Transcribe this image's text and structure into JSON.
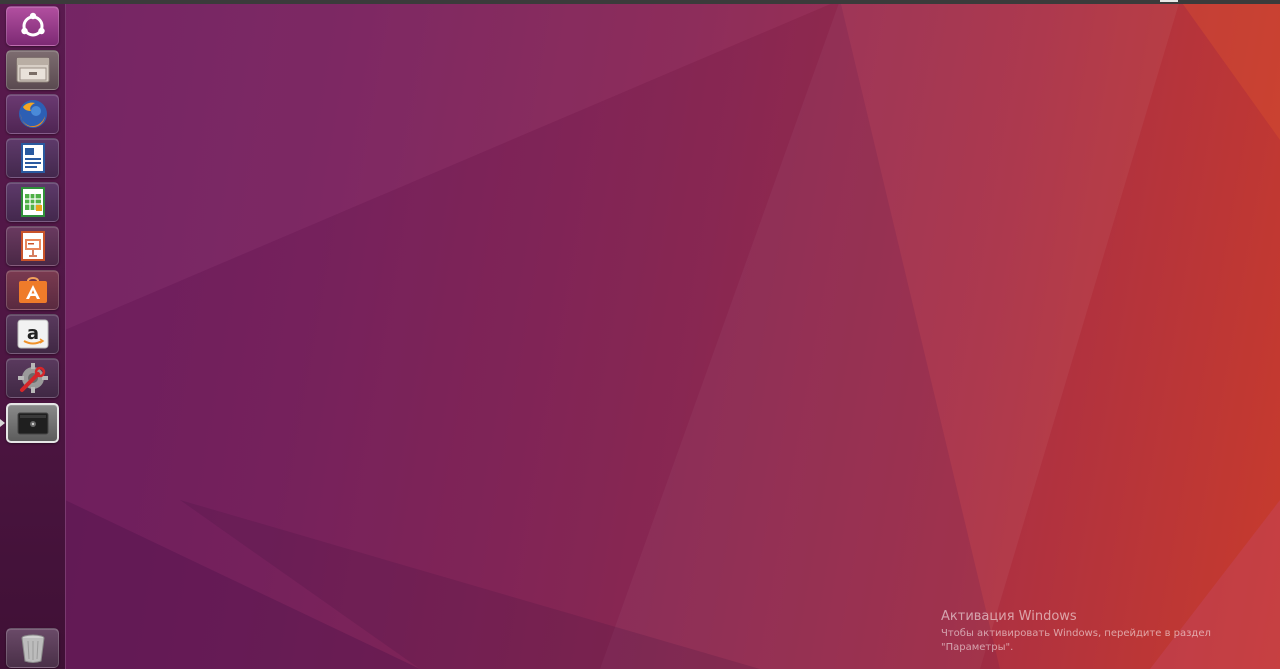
{
  "desktop": {
    "accent_colors": {
      "wallpaper_left": "#6d1f62",
      "wallpaper_right": "#c83b2c",
      "launcher": "#4c1541"
    }
  },
  "launcher": {
    "items": [
      {
        "id": "dash",
        "icon": "ubuntu-dash-icon"
      },
      {
        "id": "files",
        "icon": "files-cabinet-icon"
      },
      {
        "id": "firefox",
        "icon": "firefox-icon"
      },
      {
        "id": "writer",
        "icon": "libreoffice-writer-icon"
      },
      {
        "id": "calc",
        "icon": "libreoffice-calc-icon"
      },
      {
        "id": "impress",
        "icon": "libreoffice-impress-icon"
      },
      {
        "id": "software",
        "icon": "software-center-icon"
      },
      {
        "id": "amazon",
        "icon": "amazon-icon"
      },
      {
        "id": "settings",
        "icon": "system-settings-icon"
      },
      {
        "id": "device",
        "icon": "device-drive-icon",
        "active": true
      }
    ],
    "trash": {
      "icon": "trash-icon"
    }
  },
  "watermark": {
    "title": "Активация Windows",
    "subtitle": "Чтобы активировать Windows, перейдите в раздел \"Параметры\"."
  }
}
